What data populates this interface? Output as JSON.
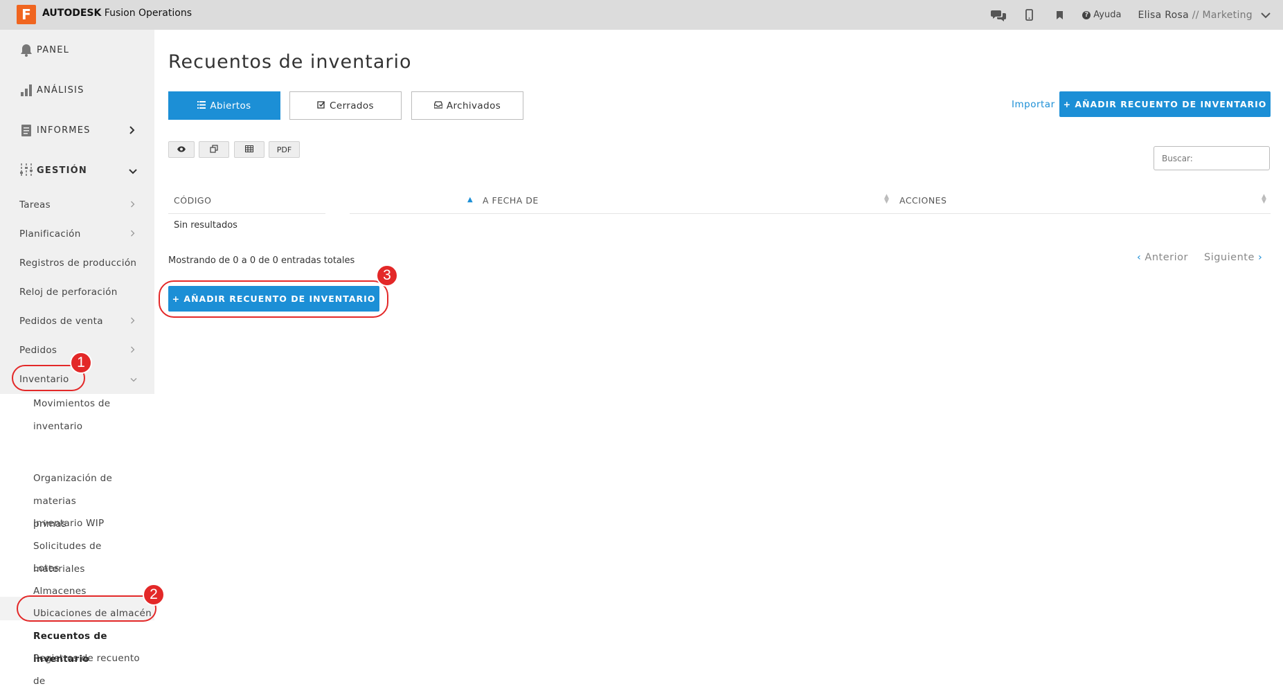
{
  "app": {
    "logo_letter": "F",
    "brand_bold": "AUTODESK",
    "brand_rest": " Fusion Operations"
  },
  "topbar": {
    "help_label": "Ayuda",
    "user_name": "Elisa Rosa",
    "user_separator": " // ",
    "user_role": "Marketing",
    "icons": [
      "chat-icon",
      "mobile-icon",
      "bookmark-icon",
      "help-icon",
      "chevron-down-icon"
    ]
  },
  "sidebar": {
    "main": [
      {
        "label": "PANEL",
        "icon": "bell-icon"
      },
      {
        "label": "ANÁLISIS",
        "icon": "bar-chart-icon"
      },
      {
        "label": "INFORMES",
        "icon": "document-icon"
      },
      {
        "label": "GESTIÓN",
        "icon": "sliders-icon"
      }
    ],
    "gestion_items": [
      {
        "label": "Tareas",
        "has_arrow": true
      },
      {
        "label": "Planificación",
        "has_arrow": true
      },
      {
        "label": "Registros de producción",
        "has_arrow": false
      },
      {
        "label": "Reloj de perforación",
        "has_arrow": false
      },
      {
        "label": "Pedidos de venta",
        "has_arrow": true
      },
      {
        "label": "Pedidos",
        "has_arrow": true
      },
      {
        "label": "Inventario",
        "has_arrow": true
      }
    ],
    "inventario_items": [
      {
        "line1": "Movimientos de",
        "line2": "inventario"
      },
      {
        "line1": "Organización de materias",
        "line2": "primas"
      },
      {
        "line1": "Inventario WIP"
      },
      {
        "line1": "Solicitudes de materiales"
      },
      {
        "line1": "Lotes"
      },
      {
        "line1": "Almacenes"
      },
      {
        "line1": "Ubicaciones de almacén"
      },
      {
        "line1": "Recuentos de inventario",
        "active": true
      },
      {
        "line1": "Registros de recuento de"
      }
    ]
  },
  "main": {
    "title": "Recuentos de inventario",
    "tabs": [
      {
        "label": "Abiertos",
        "active": true,
        "icon": "list-icon"
      },
      {
        "label": "Cerrados",
        "active": false,
        "icon": "check-square-icon"
      },
      {
        "label": "Archivados",
        "active": false,
        "icon": "inbox-icon"
      }
    ],
    "import_label": "Importar",
    "add_button_label": "+ AÑADIR RECUENTO DE INVENTARIO",
    "toolbar": [
      {
        "label": "",
        "icon": "eye-icon"
      },
      {
        "label": "",
        "icon": "copy-icon"
      },
      {
        "label": "",
        "icon": "table-icon"
      },
      {
        "label": "PDF",
        "icon": ""
      }
    ],
    "search_placeholder": "Buscar:",
    "table": {
      "columns": [
        "CÓDIGO",
        "A FECHA DE",
        "ACCIONES"
      ],
      "empty_text": "Sin resultados"
    },
    "footer_info": "Mostrando de 0 a 0 de 0 entradas totales",
    "pager": {
      "prev": "Anterior",
      "next": "Siguiente"
    },
    "add_button_bottom_label": "+ AÑADIR RECUENTO DE INVENTARIO"
  },
  "annotations": {
    "badges": [
      "1",
      "2",
      "3"
    ],
    "color": "#e32828"
  },
  "colors": {
    "primary": "#1c8fd6",
    "topbar_bg": "#dcdcdc",
    "sidebar_bg": "#f0f0f0",
    "brand_orange": "#f0651f"
  }
}
